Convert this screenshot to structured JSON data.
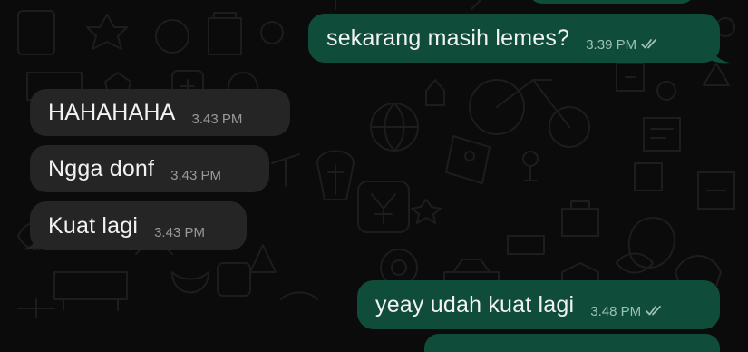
{
  "colors": {
    "background": "#0b0b0b",
    "incoming_bubble": "#252525",
    "outgoing_bubble": "#0f4d3a",
    "message_text": "#f2f2f2",
    "timestamp_text": "#9a9a9a",
    "read_ticks": "#9fc1b3"
  },
  "messages": [
    {
      "direction": "outgoing",
      "text": "sekarang masih lemes?",
      "time": "3.39 PM",
      "status": "read",
      "status_icon": "double-check-icon"
    },
    {
      "direction": "incoming",
      "text": "HAHAHAHA",
      "time": "3.43 PM"
    },
    {
      "direction": "incoming",
      "text": "Ngga donf",
      "time": "3.43 PM"
    },
    {
      "direction": "incoming",
      "text": "Kuat lagi",
      "time": "3.43 PM"
    },
    {
      "direction": "outgoing",
      "text": "yeay udah kuat lagi",
      "time": "3.48 PM",
      "status": "read",
      "status_icon": "double-check-icon"
    }
  ]
}
